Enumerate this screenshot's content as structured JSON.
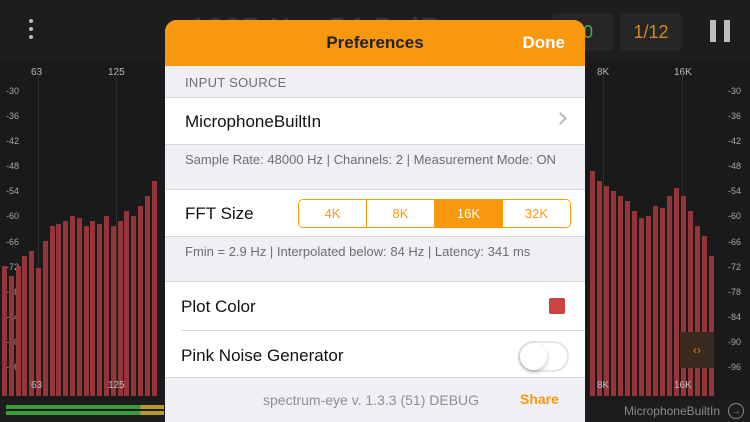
{
  "app": {
    "readout": "1697 Hz  -54.5 dB",
    "chip_green": "00",
    "chip_page": "1/12",
    "freq_labels_top": [
      "63",
      "125",
      "8K",
      "16K"
    ],
    "freq_labels_bottom": [
      "63",
      "125",
      "8K",
      "16K"
    ],
    "db_labels": [
      "-30",
      "-36",
      "-42",
      "-48",
      "-54",
      "-60",
      "-66",
      "-72",
      "-78",
      "-84",
      "-90",
      "-96"
    ],
    "nav_arrows": "‹›",
    "footer_source": "MicrophoneBuiltIn"
  },
  "modal": {
    "title": "Preferences",
    "done_label": "Done",
    "input_source_header": "INPUT SOURCE",
    "input_source_value": "MicrophoneBuiltIn",
    "input_caption": "Sample Rate: 48000 Hz | Channels: 2 | Measurement Mode: ON",
    "fft_label": "FFT Size",
    "fft_options": [
      "4K",
      "8K",
      "16K",
      "32K"
    ],
    "fft_selected": "16K",
    "fft_caption": "Fmin = 2.9 Hz  |  Interpolated below: 84 Hz  |  Latency: 341 ms",
    "plot_color_label": "Plot Color",
    "plot_color_value": "#c84445",
    "pink_noise_label": "Pink Noise Generator",
    "pink_noise_on": false,
    "version": "spectrum-eye v. 1.3.3 (51) DEBUG",
    "share_label": "Share"
  },
  "colors": {
    "accent": "#f8980f",
    "bar": "#93353b",
    "meter_green": "#3c9a3a"
  },
  "icons": [
    "kebab-menu-icon",
    "pause-icon",
    "chevron-right-icon",
    "input-switch-icon",
    "pan-arrows-icon"
  ]
}
